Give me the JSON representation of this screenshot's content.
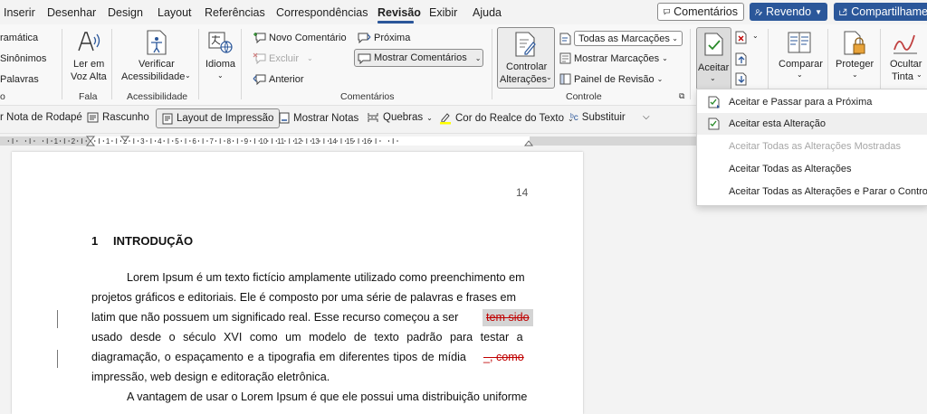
{
  "tabs": [
    {
      "label": "Inserir"
    },
    {
      "label": "Desenhar"
    },
    {
      "label": "Design"
    },
    {
      "label": "Layout"
    },
    {
      "label": "Referências"
    },
    {
      "label": "Correspondências"
    },
    {
      "label": "Revisão"
    },
    {
      "label": "Exibir"
    },
    {
      "label": "Ajuda"
    }
  ],
  "topbar": {
    "comments": "Comentários",
    "editing": "Revendo",
    "share": "Compartilhame"
  },
  "ribbon": {
    "proofing": {
      "grammar": "ramática",
      "synonyms": "Sinônimos",
      "words": "Palavras",
      "group": "o"
    },
    "speech": {
      "read_aloud_1": "Ler em",
      "read_aloud_2": "Voz Alta",
      "group": "Fala"
    },
    "accessibility": {
      "check_1": "Verificar",
      "check_2": "Acessibilidade",
      "group": "Acessibilidade"
    },
    "language": {
      "label": "Idioma"
    },
    "comments": {
      "new": "Novo Comentário",
      "delete": "Excluir",
      "previous": "Anterior",
      "next": "Próxima",
      "show": "Mostrar Comentários",
      "group": "Comentários"
    },
    "tracking": {
      "track_1": "Controlar",
      "track_2": "Alterações",
      "markup_select": "Todas as Marcações",
      "show_markup": "Mostrar Marcações",
      "review_pane": "Painel de Revisão",
      "group": "Controle"
    },
    "changes": {
      "accept": "Aceitar"
    },
    "compare": {
      "label": "Comparar"
    },
    "protect": {
      "label": "Proteger"
    },
    "ink": {
      "label_1": "Ocultar",
      "label_2": "Tinta"
    }
  },
  "quickbar": {
    "footnote": "r Nota de Rodapé",
    "draft": "Rascunho",
    "print_layout": "Layout de Impressão",
    "show_notes": "Mostrar Notas",
    "breaks": "Quebras",
    "highlight": "Cor do Realce do Texto",
    "replace": "Substituir"
  },
  "ruler": {
    "numbers": [
      "1",
      "2",
      "1",
      "2",
      "3",
      "4",
      "5",
      "6",
      "7",
      "8",
      "9",
      "10",
      "11",
      "12",
      "13",
      "14",
      "15",
      "16"
    ]
  },
  "document": {
    "page_number": "14",
    "heading_number": "1",
    "heading": "INTRODUÇÃO",
    "lines": [
      "Lorem Ipsum é um texto fictício amplamente utilizado como preenchimento em",
      "projetos gráficos e editoriais. Ele é composto por uma série de palavras e frases em",
      "latim que não possuem um significado real. Esse recurso começou a ser",
      "usado desde o século XVI como um modelo de texto padrão para testar a",
      "diagramação, o espaçamento e a tipografia em diferentes tipos de mídia",
      "impressão, web design e editoração eletrônica.",
      "A vantagem de usar o Lorem Ipsum é que ele possui uma distribuição uniforme"
    ],
    "deleted_1": "tem sido",
    "deleted_2": "_, como"
  },
  "accept_menu": {
    "items": [
      {
        "label": "Aceitar e Passar para a Próxima",
        "enabled": true
      },
      {
        "label": "Aceitar esta Alteração",
        "enabled": true
      },
      {
        "label": "Aceitar Todas as Alterações Mostradas",
        "enabled": false
      },
      {
        "label": "Aceitar Todas as Alterações",
        "enabled": true
      },
      {
        "label": "Aceitar Todas as Alterações e Parar o Controle",
        "enabled": true
      }
    ]
  },
  "colors": {
    "accent": "#2b579a",
    "deleted": "#c00000",
    "highlight": "#ffff00"
  }
}
